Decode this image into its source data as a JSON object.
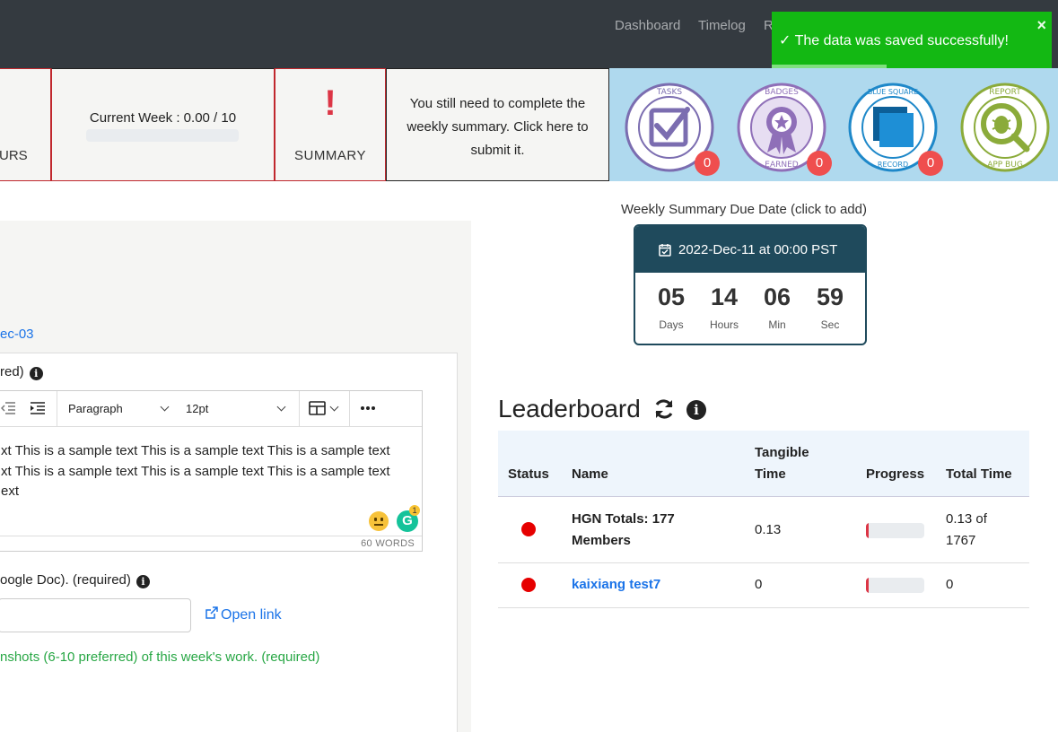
{
  "nav": {
    "items": [
      "Dashboard",
      "Timelog",
      "R"
    ]
  },
  "toast": {
    "message": "✓ The data was saved successfully!",
    "close": "×"
  },
  "status": {
    "hours_label": "URS",
    "current_week": "Current Week : 0.00 / 10",
    "week_progress": 0,
    "exclaim": "!",
    "summary_label": "SUMMARY",
    "notice": "You still need to complete the weekly summary. Click here to submit it."
  },
  "badges": [
    {
      "icon": "tasks-badge-icon",
      "count": "0"
    },
    {
      "icon": "badges-earned-icon",
      "count": "0"
    },
    {
      "icon": "blue-square-record-icon",
      "count": "0"
    },
    {
      "icon": "report-app-bug-icon",
      "count": "0"
    }
  ],
  "form": {
    "date_link": "ec-03",
    "summary_label": "red)",
    "toolbar": {
      "paragraph": "Paragraph",
      "font_size": "12pt"
    },
    "editor_text": "xt This is a sample text This is a sample text This is a sample text\nxt This is a sample text This is a sample text This is a sample text\next",
    "grammarly_count": "1",
    "word_count": "60 WORDS",
    "doc_label": "oogle Doc). (required)",
    "link_value": "",
    "open_link": "Open link",
    "screenshots_label": "nshots (6-10 preferred) of this week's work. (required)"
  },
  "due": {
    "label": "Weekly Summary Due Date (click to add)",
    "date": "2022-Dec-11 at 00:00 PST",
    "days": "05",
    "days_unit": "Days",
    "hours": "14",
    "hours_unit": "Hours",
    "min": "06",
    "min_unit": "Min",
    "sec": "59",
    "sec_unit": "Sec"
  },
  "leaderboard": {
    "title": "Leaderboard",
    "columns": {
      "status": "Status",
      "name": "Name",
      "tangible_1": "Tangible",
      "tangible_2": "Time",
      "progress": "Progress",
      "total": "Total Time"
    },
    "rows": [
      {
        "name_1": "HGN Totals: 177",
        "name_2": "Members",
        "tangible": "0.13",
        "progress": 0.04,
        "total_1": "0.13 of",
        "total_2": "1767"
      },
      {
        "name": "kaixiang test7",
        "tangible": "0",
        "progress": 0.04,
        "total": "0"
      }
    ]
  },
  "colors": {
    "navbar": "#343a40",
    "toast": "#13b813",
    "badges_bg": "#afd9ee",
    "timer_head": "#1f4a5c",
    "status_red": "#e60000",
    "link_blue": "#1a73e8"
  }
}
